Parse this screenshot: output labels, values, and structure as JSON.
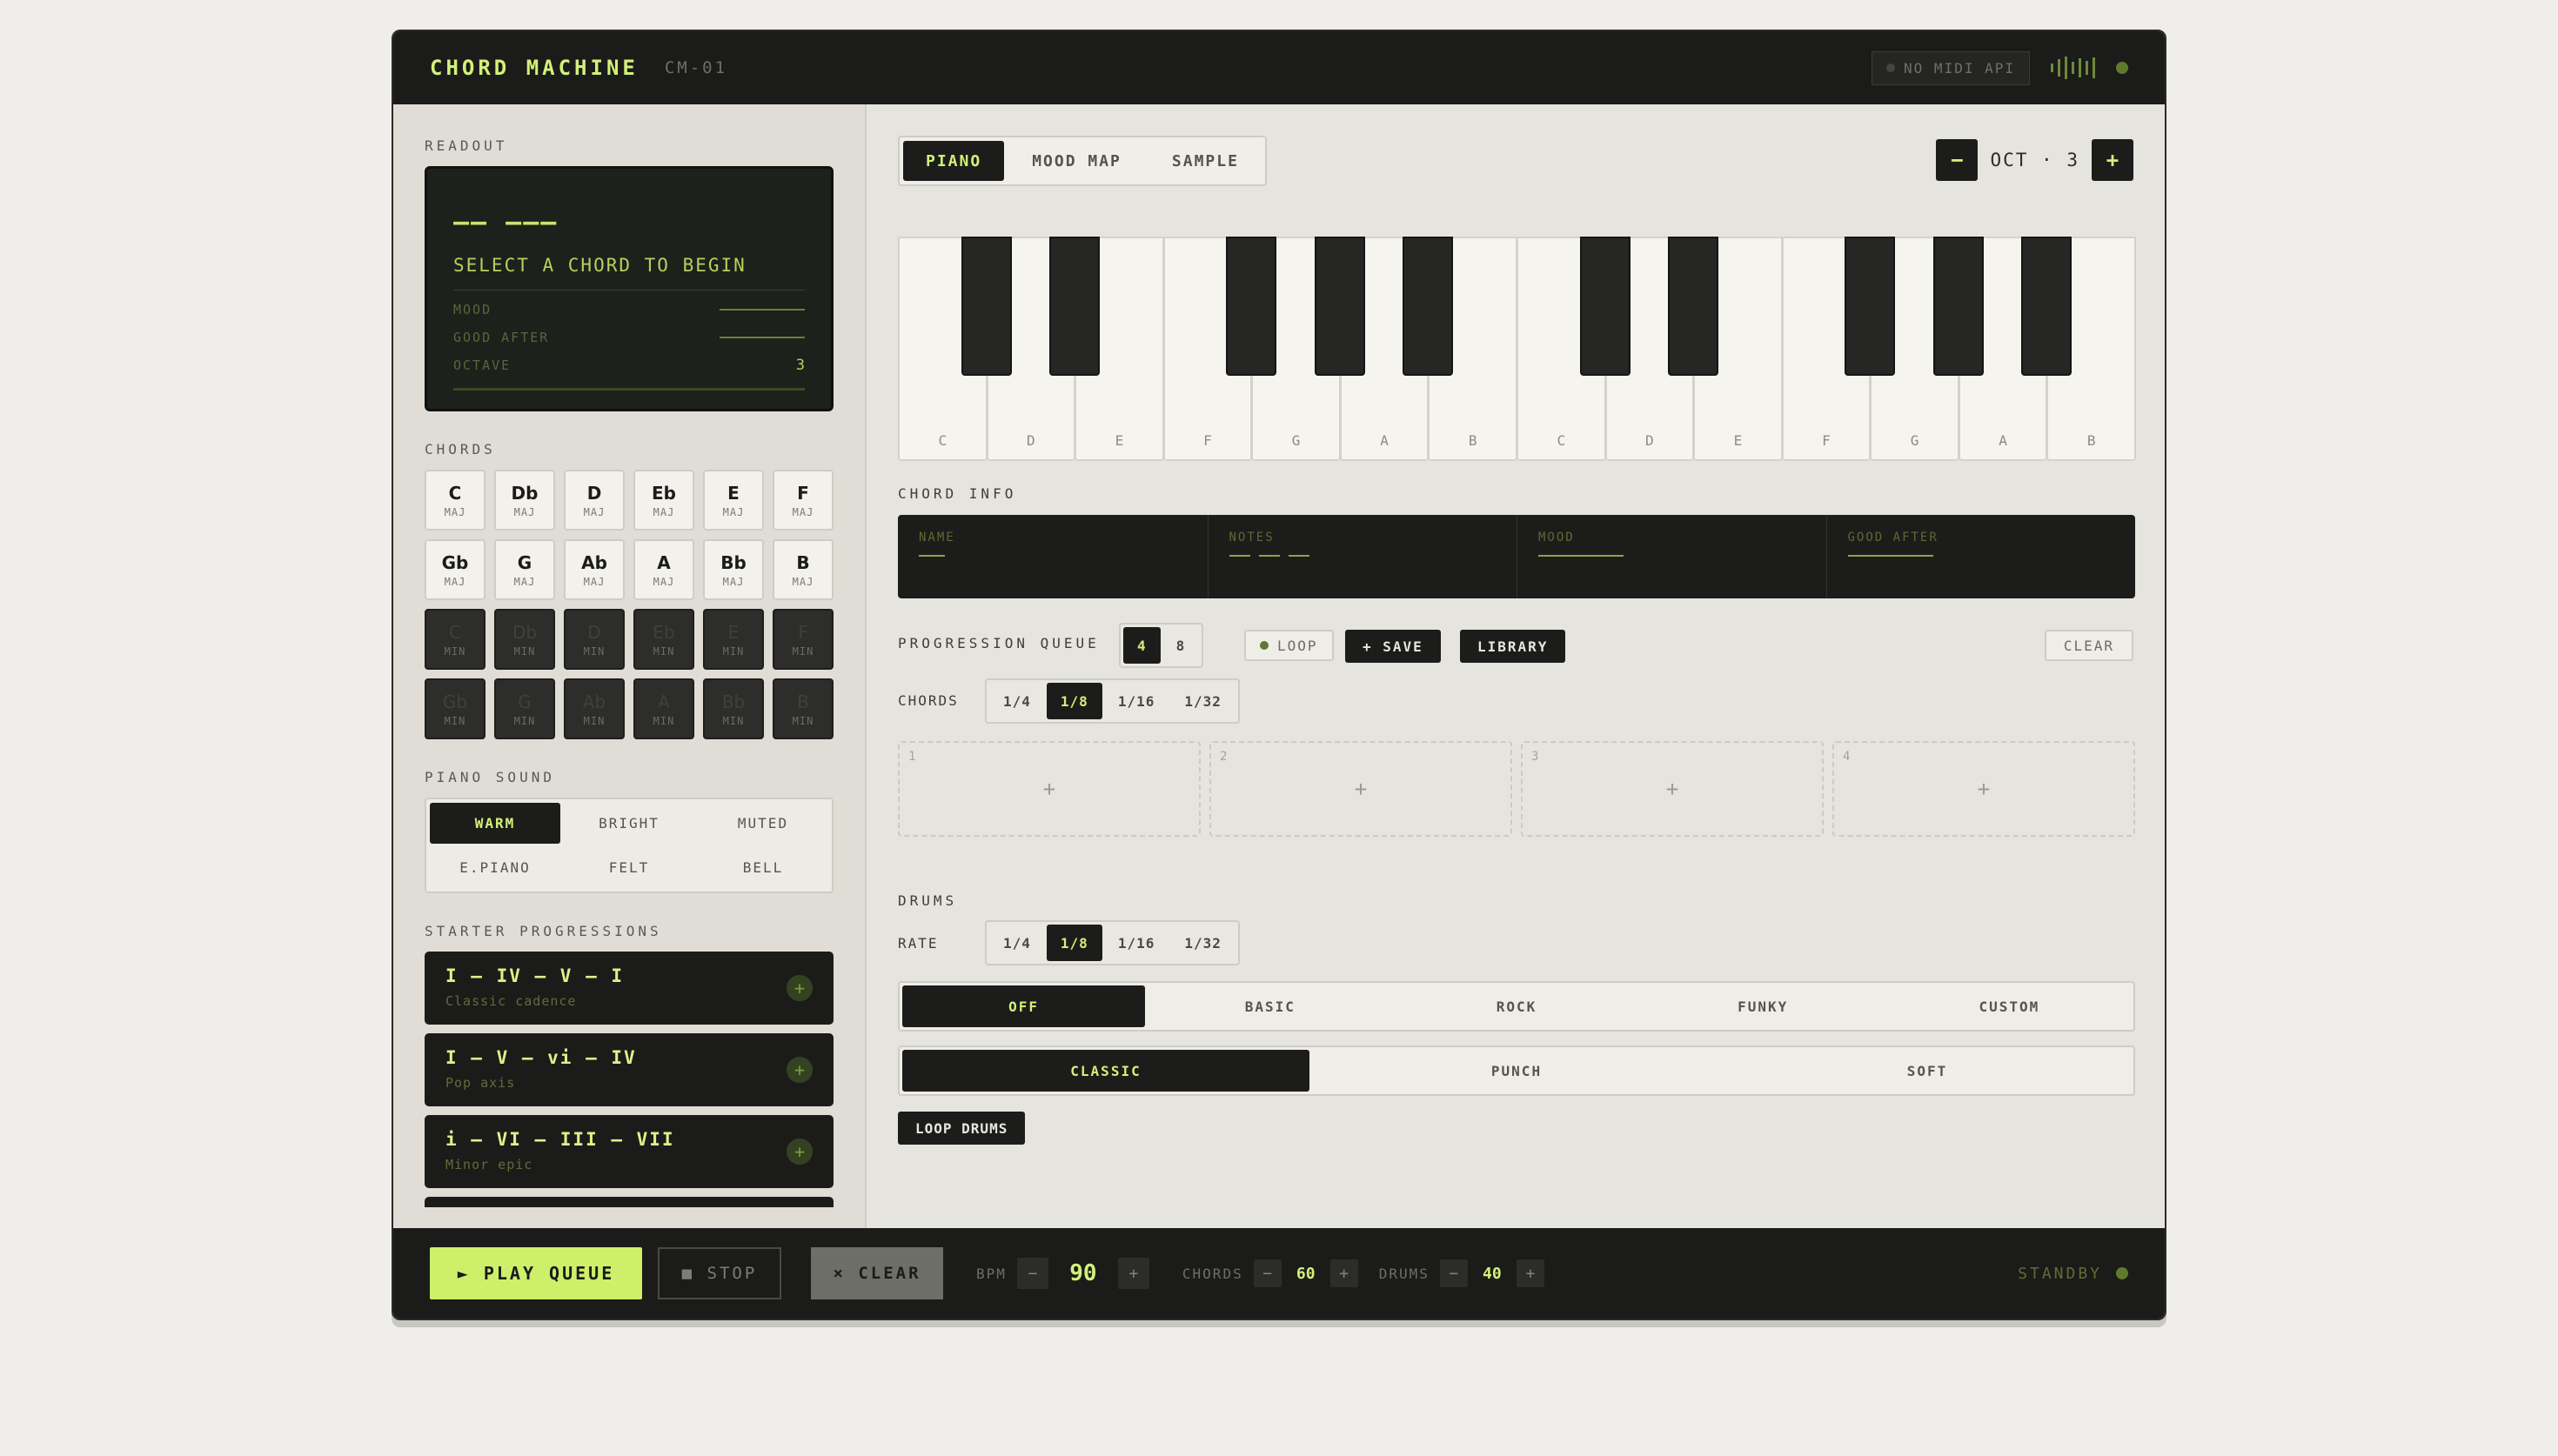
{
  "header": {
    "brand": "CHORD MACHINE",
    "model": "CM-01",
    "midi_status": "NO MIDI API"
  },
  "readout": {
    "section": "READOUT",
    "chord_placeholder": "—— ———",
    "message": "SELECT A CHORD TO BEGIN",
    "rows": [
      {
        "label": "MOOD",
        "value": ""
      },
      {
        "label": "GOOD AFTER",
        "value": ""
      },
      {
        "label": "OCTAVE",
        "value": "3"
      }
    ]
  },
  "chords": {
    "section": "CHORDS",
    "major": [
      {
        "name": "C",
        "quality": "MAJ"
      },
      {
        "name": "Db",
        "quality": "MAJ"
      },
      {
        "name": "D",
        "quality": "MAJ"
      },
      {
        "name": "Eb",
        "quality": "MAJ"
      },
      {
        "name": "E",
        "quality": "MAJ"
      },
      {
        "name": "F",
        "quality": "MAJ"
      },
      {
        "name": "Gb",
        "quality": "MAJ"
      },
      {
        "name": "G",
        "quality": "MAJ"
      },
      {
        "name": "Ab",
        "quality": "MAJ"
      },
      {
        "name": "A",
        "quality": "MAJ"
      },
      {
        "name": "Bb",
        "quality": "MAJ"
      },
      {
        "name": "B",
        "quality": "MAJ"
      }
    ],
    "minor": [
      {
        "name": "C",
        "quality": "MIN"
      },
      {
        "name": "Db",
        "quality": "MIN"
      },
      {
        "name": "D",
        "quality": "MIN"
      },
      {
        "name": "Eb",
        "quality": "MIN"
      },
      {
        "name": "E",
        "quality": "MIN"
      },
      {
        "name": "F",
        "quality": "MIN"
      },
      {
        "name": "Gb",
        "quality": "MIN"
      },
      {
        "name": "G",
        "quality": "MIN"
      },
      {
        "name": "Ab",
        "quality": "MIN"
      },
      {
        "name": "A",
        "quality": "MIN"
      },
      {
        "name": "Bb",
        "quality": "MIN"
      },
      {
        "name": "B",
        "quality": "MIN"
      }
    ]
  },
  "piano_sound": {
    "section": "PIANO SOUND",
    "options": [
      "WARM",
      "BRIGHT",
      "MUTED",
      "E.PIANO",
      "FELT",
      "BELL"
    ],
    "selected": "WARM"
  },
  "starters": {
    "section": "STARTER PROGRESSIONS",
    "items": [
      {
        "title": "I – IV – V – I",
        "subtitle": "Classic cadence"
      },
      {
        "title": "I – V – vi – IV",
        "subtitle": "Pop axis"
      },
      {
        "title": "i – VI – III – VII",
        "subtitle": "Minor epic"
      }
    ]
  },
  "tabs": {
    "items": [
      "PIANO",
      "MOOD MAP",
      "SAMPLE"
    ],
    "selected": "PIANO"
  },
  "octave": {
    "label": "OCT · 3",
    "minus": "−",
    "plus": "+"
  },
  "piano": {
    "white_keys": [
      "C",
      "D",
      "E",
      "F",
      "G",
      "A",
      "B",
      "C",
      "D",
      "E",
      "F",
      "G",
      "A",
      "B"
    ]
  },
  "chord_info": {
    "section": "CHORD INFO",
    "cells": [
      {
        "label": "NAME",
        "value": ""
      },
      {
        "label": "NOTES",
        "value": ""
      },
      {
        "label": "MOOD",
        "value": ""
      },
      {
        "label": "GOOD AFTER",
        "value": ""
      }
    ]
  },
  "queue": {
    "section": "PROGRESSION QUEUE",
    "lengths": [
      "4",
      "8"
    ],
    "length_selected": "4",
    "loop_label": "LOOP",
    "save_label": "+ SAVE",
    "library_label": "LIBRARY",
    "clear_label": "CLEAR",
    "chords_label": "CHORDS",
    "rates": [
      "1/4",
      "1/8",
      "1/16",
      "1/32"
    ],
    "rate_selected": "1/8",
    "slots": [
      {
        "num": "1",
        "plus": "+"
      },
      {
        "num": "2",
        "plus": "+"
      },
      {
        "num": "3",
        "plus": "+"
      },
      {
        "num": "4",
        "plus": "+"
      }
    ]
  },
  "drums": {
    "section": "DRUMS",
    "rate_label": "RATE",
    "rates": [
      "1/4",
      "1/8",
      "1/16",
      "1/32"
    ],
    "rate_selected": "1/8",
    "patterns": [
      "OFF",
      "BASIC",
      "ROCK",
      "FUNKY",
      "CUSTOM"
    ],
    "pattern_selected": "OFF",
    "kits": [
      "CLASSIC",
      "PUNCH",
      "SOFT"
    ],
    "kit_selected": "CLASSIC",
    "loop_label": "LOOP DRUMS"
  },
  "transport": {
    "play_label": "► PLAY QUEUE",
    "stop_label": "■ STOP",
    "clear_label": "× CLEAR",
    "bpm_label": "BPM",
    "bpm": "90",
    "chords_label": "CHORDS",
    "chords_vol": "60",
    "drums_label": "DRUMS",
    "drums_vol": "40",
    "status": "STANDBY"
  },
  "colors": {
    "accent": "#d3f07a",
    "panel_dark": "#1b1b19",
    "background": "#efeeea"
  }
}
